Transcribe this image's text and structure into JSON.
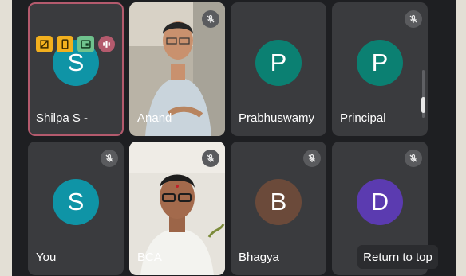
{
  "participants": [
    {
      "name": "Shilpa S -",
      "initial": "S",
      "avatar_color": "#0f94a6",
      "muted": false,
      "speaking": true
    },
    {
      "name": "Anand",
      "initial": "",
      "avatar_color": "",
      "muted": true,
      "speaking": false
    },
    {
      "name": "Prabhuswamy",
      "initial": "P",
      "avatar_color": "#0b8072",
      "muted": false,
      "speaking": false
    },
    {
      "name": "Principal",
      "initial": "P",
      "avatar_color": "#0b8072",
      "muted": true,
      "speaking": false
    },
    {
      "name": "You",
      "initial": "S",
      "avatar_color": "#0f94a6",
      "muted": true,
      "speaking": false
    },
    {
      "name": "BCA",
      "initial": "",
      "avatar_color": "",
      "muted": true,
      "speaking": false
    },
    {
      "name": "Bhagya",
      "initial": "B",
      "avatar_color": "#6b4a3a",
      "muted": true,
      "speaking": false
    },
    {
      "name": "",
      "initial": "D",
      "avatar_color": "#5b3bb0",
      "muted": true,
      "speaking": false
    }
  ],
  "status_badges": [
    "host-controls-icon",
    "phone-icon",
    "cast-icon",
    "audio-level-icon"
  ],
  "return_to_top_label": "Return to top",
  "colors": {
    "background": "#1e1f22",
    "tile": "#3a3b3e",
    "speaking_border": "#b45a6d",
    "active_dot": "#33c26a"
  }
}
